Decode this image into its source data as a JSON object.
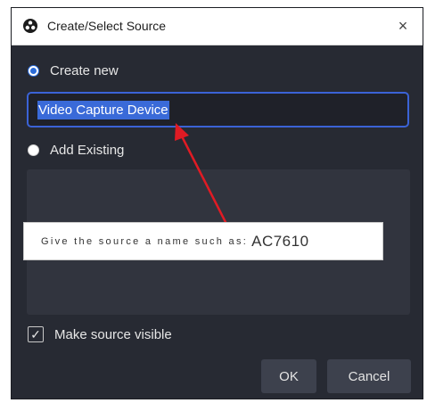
{
  "window": {
    "title": "Create/Select Source",
    "close_glyph": "×",
    "app_icon": "obs-icon",
    "close_icon": "close-icon"
  },
  "create_new": {
    "label": "Create new",
    "selected": true
  },
  "name_input": {
    "value": "Video Capture Device"
  },
  "add_existing": {
    "label": "Add Existing",
    "selected": false
  },
  "annotation": {
    "text_small": "Give the source a name such as:",
    "text_big": "AC7610",
    "arrow_color": "#e01b24"
  },
  "make_visible": {
    "label": "Make source visible",
    "checked": true,
    "check_glyph": "✓"
  },
  "buttons": {
    "ok": "OK",
    "cancel": "Cancel"
  },
  "colors": {
    "dialog_bg": "#272a33",
    "accent": "#3a6ad8"
  }
}
